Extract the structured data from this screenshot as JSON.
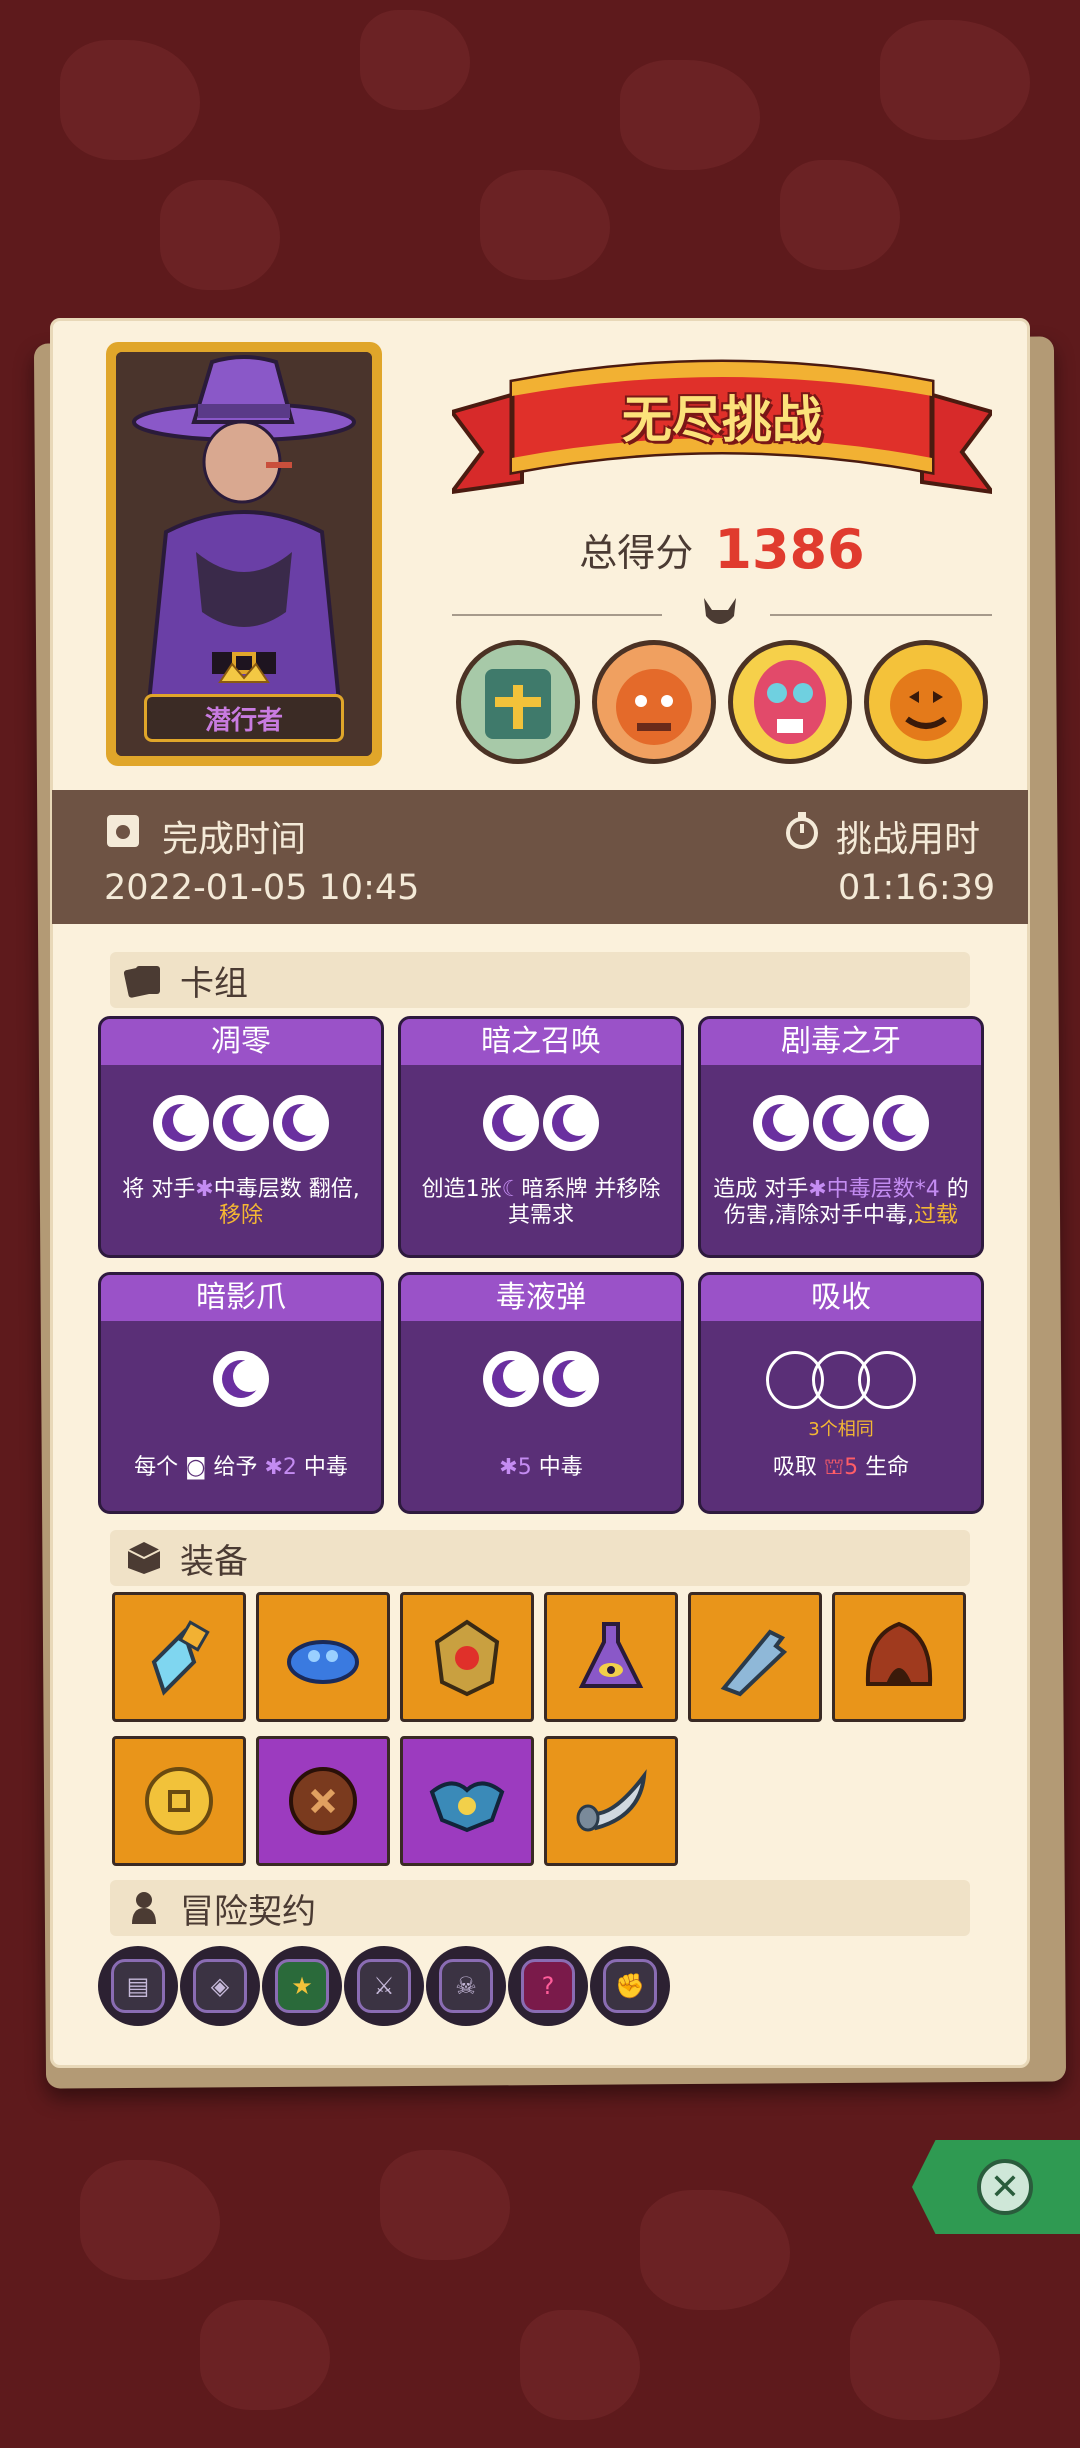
{
  "hero": {
    "name": "潜行者"
  },
  "banner": {
    "title": "无尽挑战"
  },
  "score": {
    "label": "总得分",
    "value": "1386"
  },
  "time": {
    "completed_label": "完成时间",
    "completed_value": "2022-01-05 10:45",
    "duration_label": "挑战用时",
    "duration_value": "01:16:39"
  },
  "deck": {
    "title": "卡组",
    "cards": [
      {
        "name": "凋零",
        "desc_parts": [
          "将 对手",
          "中毒层数 翻倍,",
          "移除"
        ]
      },
      {
        "name": "暗之召唤",
        "desc_parts": [
          "创造1张",
          "暗系牌 并移除",
          "其需求"
        ]
      },
      {
        "name": "剧毒之牙",
        "desc_parts": [
          "造成 对手",
          "中毒层数*4",
          "的",
          "伤害,清除对手中毒,",
          "过载"
        ]
      },
      {
        "name": "暗影爪",
        "desc_parts": [
          "每个",
          "给予",
          "2",
          "中毒"
        ]
      },
      {
        "name": "毒液弹",
        "desc_parts": [
          "5",
          "中毒"
        ]
      },
      {
        "name": "吸收",
        "same_label": "3个相同",
        "desc_parts": [
          "吸取",
          "5",
          "生命"
        ]
      }
    ]
  },
  "equipment": {
    "title": "装备",
    "items": [
      {
        "icon": "blue-crystal-icon",
        "rarity": "orange"
      },
      {
        "icon": "blue-slime-icon",
        "rarity": "orange"
      },
      {
        "icon": "gold-shield-icon",
        "rarity": "orange"
      },
      {
        "icon": "eye-potion-icon",
        "rarity": "orange"
      },
      {
        "icon": "broken-blade-icon",
        "rarity": "orange"
      },
      {
        "icon": "hood-icon",
        "rarity": "orange"
      },
      {
        "icon": "gold-coin-icon",
        "rarity": "orange"
      },
      {
        "icon": "button-icon",
        "rarity": "purple"
      },
      {
        "icon": "bat-crest-icon",
        "rarity": "purple"
      },
      {
        "icon": "horn-icon",
        "rarity": "orange"
      }
    ]
  },
  "contracts": {
    "title": "冒险契约",
    "items": [
      {
        "icon": "card-contract-icon",
        "glyph": "▤"
      },
      {
        "icon": "shield-contract-icon",
        "glyph": "◈"
      },
      {
        "icon": "star-contract-icon",
        "glyph": "★"
      },
      {
        "icon": "sword-contract-icon",
        "glyph": "⚔"
      },
      {
        "icon": "skull-contract-icon",
        "glyph": "☠"
      },
      {
        "icon": "question-contract-icon",
        "glyph": "?"
      },
      {
        "icon": "fist-contract-icon",
        "glyph": "✊"
      }
    ]
  },
  "colors": {
    "background": "#5e1a1c",
    "panel": "#fbf1dc",
    "score_red": "#e03b2e",
    "card_purple": "#5a2f77",
    "card_header": "#9a52c8",
    "equip_orange": "#e9951a",
    "equip_purple": "#9c3bbf",
    "close_green": "#2f9a52"
  }
}
